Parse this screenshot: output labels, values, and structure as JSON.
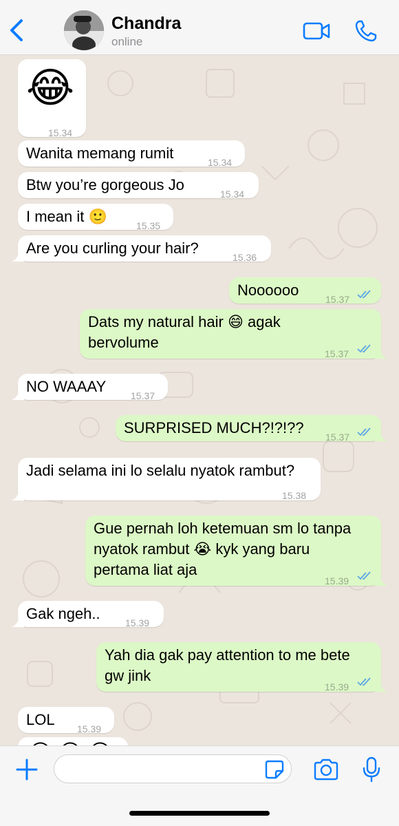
{
  "header": {
    "contact_name": "Chandra",
    "status": "online",
    "icons": {
      "back": "chevron-left-icon",
      "video": "video-camera-icon",
      "call": "phone-icon"
    }
  },
  "messages": [
    {
      "direction": "in",
      "text": "😂",
      "time": "15.34",
      "type": "emoji"
    },
    {
      "direction": "in",
      "text": "Wanita memang rumit",
      "time": "15.34"
    },
    {
      "direction": "in",
      "text": "Btw you’re gorgeous Jo",
      "time": "15.34"
    },
    {
      "direction": "in",
      "text": "I mean it 🙂",
      "time": "15.35"
    },
    {
      "direction": "in",
      "text": "Are you curling your hair?",
      "time": "15.36"
    },
    {
      "direction": "out",
      "text": "Noooooo",
      "time": "15.37",
      "read": true
    },
    {
      "direction": "out",
      "text": "Dats my natural hair 😄 agak\nbervolume",
      "time": "15.37",
      "read": true
    },
    {
      "direction": "in",
      "text": "NO WAAAY",
      "time": "15.37"
    },
    {
      "direction": "out",
      "text": "SURPRISED MUCH?!?!??",
      "time": "15.37",
      "read": true
    },
    {
      "direction": "in",
      "text": "Jadi selama ini lo selalu nyatok rambut?",
      "time": "15.38"
    },
    {
      "direction": "out",
      "text": "Gue pernah loh ketemuan sm lo tanpa\nnyatok rambut 😭 kyk yang baru\npertama liat aja",
      "time": "15.39",
      "read": true
    },
    {
      "direction": "in",
      "text": "Gak ngeh..",
      "time": "15.39"
    },
    {
      "direction": "out",
      "text": "Yah dia gak pay attention to me bete\ngw jink",
      "time": "15.39",
      "read": true
    },
    {
      "direction": "in",
      "text": "LOL",
      "time": "15.39"
    },
    {
      "direction": "in",
      "text": "😂😂😂",
      "time": "",
      "type": "emoji-partial"
    }
  ],
  "input_bar": {
    "placeholder": "",
    "icons": {
      "plus": "plus-icon",
      "sticker": "sticker-icon",
      "camera": "camera-icon",
      "mic": "microphone-icon"
    }
  },
  "colors": {
    "accent": "#0a7cff",
    "incoming_bubble": "#ffffff",
    "outgoing_bubble": "#dcf8c6",
    "background": "#ece5dd",
    "read_ticks": "#5aa6e6"
  }
}
